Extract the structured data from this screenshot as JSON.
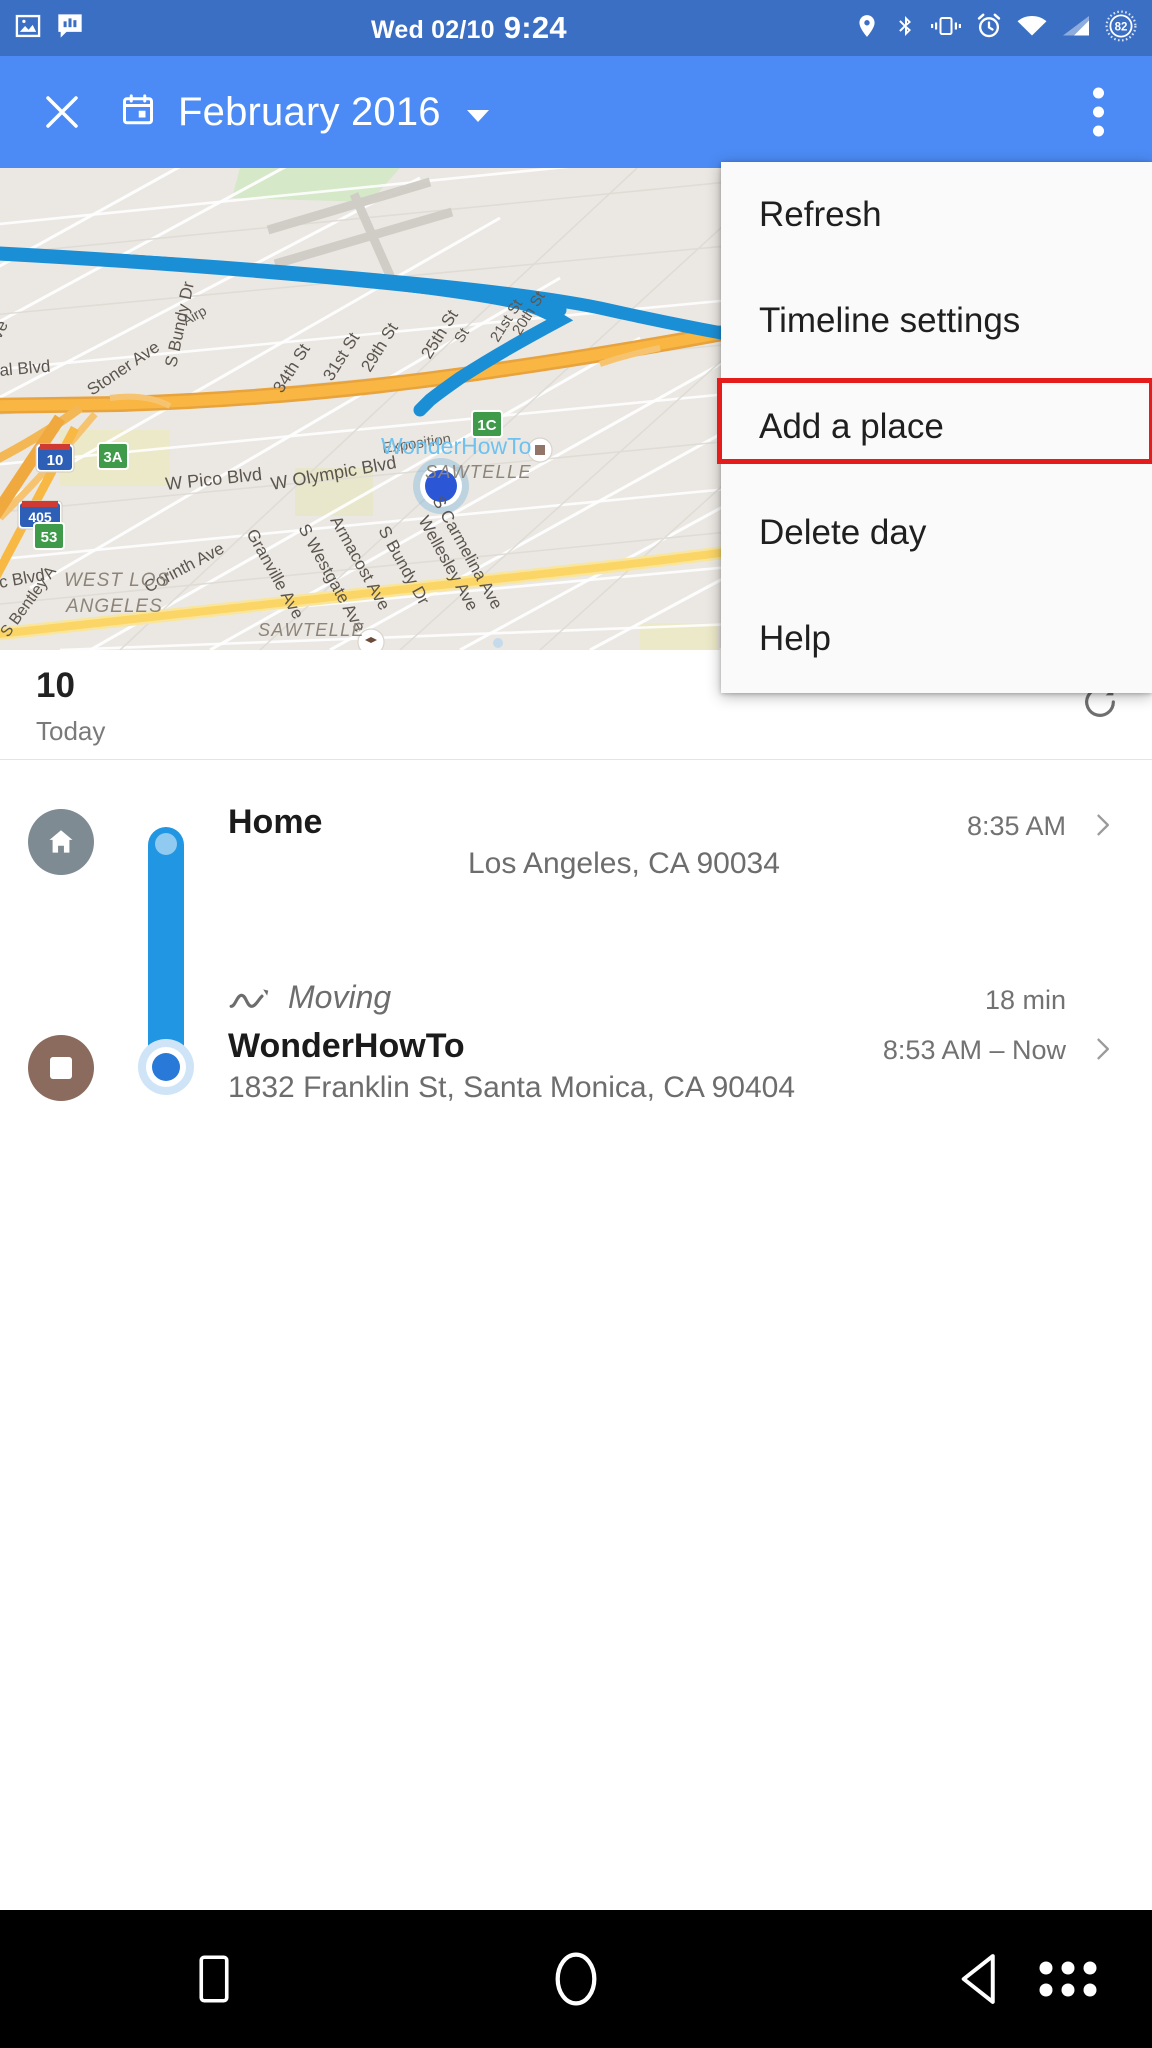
{
  "status_bar": {
    "date": "Wed 02/10",
    "time": "9:24",
    "left_icons": [
      "image-icon",
      "chat-stats-icon"
    ],
    "right_icons": [
      "location-pin-icon",
      "bluetooth-icon",
      "vibrate-icon",
      "alarm-icon",
      "wifi-icon",
      "signal-icon"
    ],
    "battery_percent": "82",
    "background_color": "#3b6fc4"
  },
  "app_bar": {
    "close_label": "×",
    "calendar_icon": "calendar-icon",
    "title": "February 2016",
    "dropdown_icon": "caret-down-icon",
    "overflow_icon": "overflow-menu-icon",
    "background_color": "#4c8bf5"
  },
  "overflow_menu": {
    "items": [
      {
        "label": "Refresh",
        "highlighted": false
      },
      {
        "label": "Timeline settings",
        "highlighted": false
      },
      {
        "label": "Add a place",
        "highlighted": true
      },
      {
        "label": "Delete day",
        "highlighted": false
      },
      {
        "label": "Help",
        "highlighted": false
      }
    ],
    "highlight_color": "#e51c1c",
    "background_color": "#fafafa"
  },
  "map": {
    "streets": [
      "S Bundy Dr",
      "Stoner Ave",
      "al Blvd",
      "34th St",
      "31st St",
      "29th St",
      "25th St",
      "21st St",
      "20th St",
      "W Pico Blvd",
      "W Olympic Blvd",
      "Granville Ave",
      "S Westgate Ave",
      "Armacost Ave",
      "S Bundy Dr",
      "Wellesley Ave",
      "S Carmelina Ave",
      "Corinth Ave",
      "S Bentley A",
      "c Blvd",
      "Exposition",
      "Airp"
    ],
    "area_labels": [
      "WEST LOS ANGELES",
      "SAWTELLE",
      "SAWTELLE"
    ],
    "place_label": "WonderHowTo",
    "highway_shields": [
      "10",
      "405"
    ],
    "exit_markers": [
      "3A",
      "53",
      "1C"
    ],
    "route_color": "#1b8fd6",
    "highway_color": "#f5a623",
    "location_dot_color": "#2b57d6"
  },
  "day_header": {
    "day_number": "10",
    "day_label": "Today",
    "refresh_icon": "refresh-icon"
  },
  "timeline": {
    "entries": [
      {
        "type": "place",
        "icon": "home-icon",
        "title": "Home",
        "subtitle": "Los Angeles, CA 90034",
        "time": "8:35 AM",
        "chevron": "chevron-right-icon"
      },
      {
        "type": "activity",
        "icon": "moving-icon",
        "title": "Moving",
        "duration": "18 min"
      },
      {
        "type": "place",
        "icon": "stop-square-icon",
        "title": "WonderHowTo",
        "subtitle": "1832 Franklin St, Santa Monica, CA 90404",
        "time": "8:53 AM – Now",
        "chevron": "chevron-right-icon"
      }
    ],
    "rail_color": "#2196e3"
  },
  "nav_bar": {
    "buttons": [
      "recents-button",
      "home-button",
      "back-button",
      "app-grid-button"
    ],
    "background_color": "#000000"
  }
}
